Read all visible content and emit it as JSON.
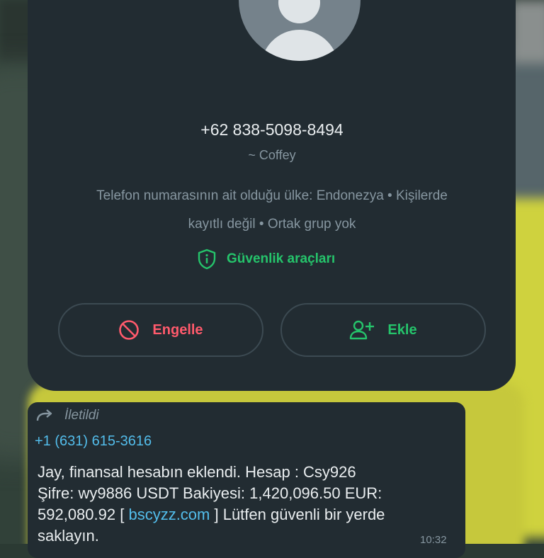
{
  "contact": {
    "phone": "+62 838-5098-8494",
    "pushname": "~ Coffey",
    "info_line1": "Telefon numarasının ait olduğu ülke: Endonezya • Kişilerde",
    "info_line2": "kayıtlı değil • Ortak grup yok",
    "security_label": "Güvenlik araçları",
    "block_label": "Engelle",
    "add_label": "Ekle"
  },
  "message": {
    "forwarded_label": "İletildi",
    "sender": "+1 (631) 615-3616",
    "text_line1": "Jay, finansal hesabın eklendi. Hesap : Csy926",
    "text_line2": "Şifre: wy9886 USDT Bakiyesi: 1,420,096.50 EUR:",
    "text_line3_pre": "592,080.92 [ ",
    "link": "bscyzz.com",
    "text_line3_post": " ] Lütfen güvenli bir yerde",
    "text_line4": "saklayın.",
    "time": "10:32"
  },
  "colors": {
    "card": "#222c32",
    "green_accent": "#25c46b",
    "red_accent": "#ff5a6c",
    "link_blue": "#53bdeb",
    "secondary_text": "#8696a0"
  },
  "icons": [
    "default-avatar-icon",
    "shield-icon",
    "block-icon",
    "add-contact-icon",
    "forward-icon"
  ]
}
